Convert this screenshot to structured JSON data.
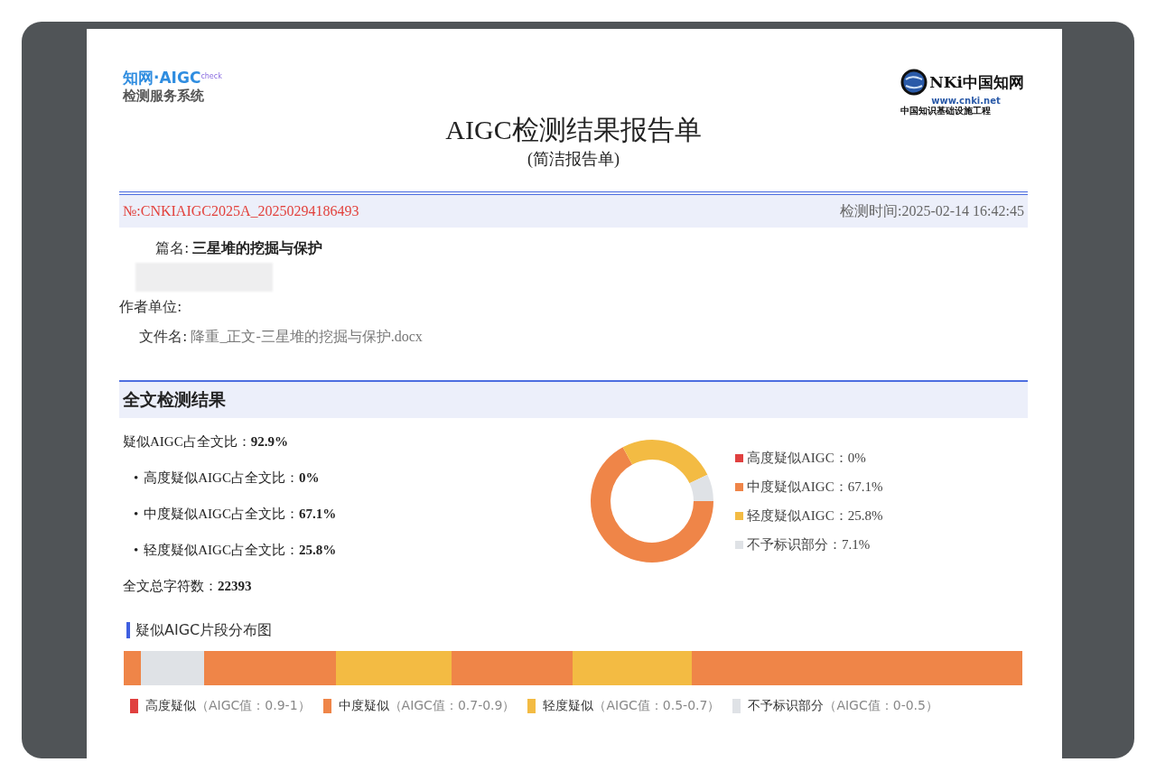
{
  "header": {
    "left_logo": {
      "brand": "知网·AIGC",
      "badge": "check",
      "subtitle": "检测服务系统"
    },
    "right_logo": {
      "brand": "NKi中国知网",
      "url": "www.cnki.net",
      "subtitle": "中国知识基础设施工程"
    },
    "title": "AIGC检测结果报告单",
    "subtitle": "(简洁报告单)"
  },
  "info_bar": {
    "number": "№:CNKIAIGC2025A_20250294186493",
    "time": "检测时间:2025-02-14 16:42:45"
  },
  "fields": [
    {
      "label": "篇名:",
      "value": "三星堆的挖掘与保护",
      "kind": "title"
    },
    {
      "kind": "blurred"
    },
    {
      "label": "作者单位:",
      "kind": "plain"
    },
    {
      "label": "文件名:",
      "value": "降重_正文-三星堆的挖掘与保护.docx",
      "kind": "file"
    }
  ],
  "section": {
    "title": "全文检测结果",
    "total": {
      "label": "疑似AIGC占全文比：",
      "value": "92.9%"
    },
    "breakdown": [
      {
        "bullet": "•",
        "label": "高度疑似AIGC占全文比：",
        "value": "0%"
      },
      {
        "bullet": "•",
        "label": "中度疑似AIGC占全文比：",
        "value": "67.1%"
      },
      {
        "bullet": "•",
        "label": "轻度疑似AIGC占全文比：",
        "value": "25.8%"
      }
    ],
    "chars": {
      "label": "全文总字符数：",
      "value": "22393"
    },
    "chart_data": {
      "type": "donut",
      "categories": [
        "高度疑似AIGC",
        "中度疑似AIGC",
        "轻度疑似AIGC",
        "不予标识部分"
      ],
      "values": [
        0,
        67.1,
        25.8,
        7.1
      ]
    },
    "donut_legend": [
      {
        "value": "：0%",
        "color": "#e0403f"
      },
      {
        "value": "：67.1%",
        "color": "#ef8548"
      },
      {
        "value": "：25.8%",
        "color": "#f3bb43"
      },
      {
        "value": "：7.1%",
        "color": "#dfe2e6"
      }
    ]
  },
  "distribution": {
    "title": "疑似AIGC片段分布图",
    "legend": [
      {
        "label": "高度疑似",
        "range": "（AIGC值：0.9-1）",
        "color": "#e0403f"
      },
      {
        "label": "中度疑似",
        "range": "（AIGC值：0.7-0.9）",
        "color": "#ef8548"
      },
      {
        "label": "轻度疑似",
        "range": "（AIGC值：0.5-0.7）",
        "color": "#f3bb43"
      },
      {
        "label": "不予标识部分",
        "range": "（AIGC值：0-0.5）",
        "color": "#dfe2e6"
      }
    ]
  }
}
